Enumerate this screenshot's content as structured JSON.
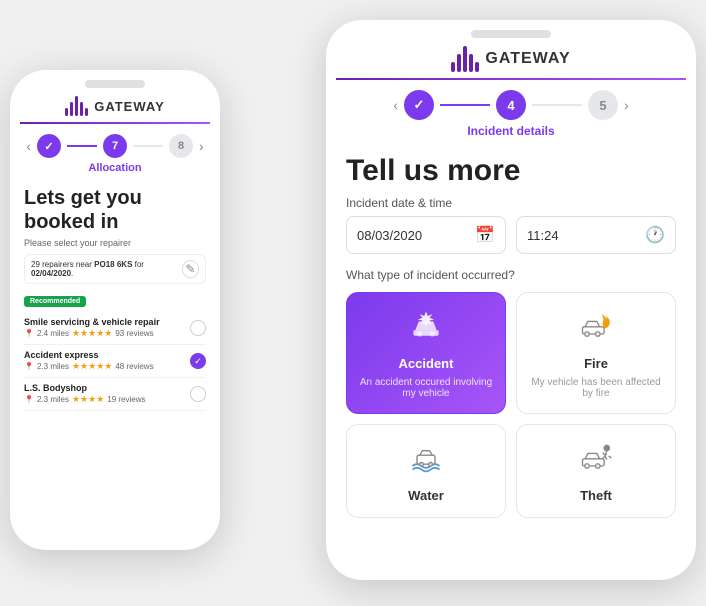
{
  "small_phone": {
    "logo_text": "GATEWAY",
    "steps": {
      "prev_arrow": "‹",
      "next_arrow": "›",
      "step_done_check": "✓",
      "step_active": "7",
      "step_inactive": "8",
      "label": "Allocation"
    },
    "headline": "Lets get you booked in",
    "subtext": "Please select your repairer",
    "repairers_row": {
      "text": "29 repairers near PO18 6KS for 02/04/2020.",
      "highlight_start": "PO18 6KS",
      "edit_icon": "✎"
    },
    "recommended_badge": "Recommended",
    "repairers": [
      {
        "name": "Smile servicing & vehicle repair",
        "distance": "2.4 miles",
        "stars": "★★★★★",
        "reviews": "93 reviews",
        "selected": false
      },
      {
        "name": "Accident express",
        "distance": "2.3 miles",
        "stars": "★★★★★",
        "reviews": "48 reviews",
        "selected": true
      },
      {
        "name": "L.S. Bodyshop",
        "distance": "2.3 miles",
        "stars": "★★★★",
        "reviews": "19 reviews",
        "selected": false
      }
    ]
  },
  "large_phone": {
    "logo_text": "GATEWAY",
    "steps": {
      "prev_arrow": "‹",
      "next_arrow": "›",
      "step_done_check": "✓",
      "step_active": "4",
      "step_inactive": "5",
      "label": "Incident details"
    },
    "page_title": "Tell us more",
    "date_label": "Incident date & time",
    "date_value": "08/03/2020",
    "time_value": "11:24",
    "calendar_icon": "📅",
    "clock_icon": "🕐",
    "incident_label": "What type of incident occurred?",
    "incident_types": [
      {
        "id": "accident",
        "title": "Accident",
        "desc": "An accident occured involving my vehicle",
        "selected": true
      },
      {
        "id": "fire",
        "title": "Fire",
        "desc": "My vehicle has been affected by fire",
        "selected": false
      },
      {
        "id": "water",
        "title": "Water",
        "desc": "",
        "selected": false
      },
      {
        "id": "theft",
        "title": "Theft",
        "desc": "",
        "selected": false
      }
    ]
  },
  "colors": {
    "purple": "#7c3aed",
    "green": "#16a34a",
    "red": "#e11d48",
    "star": "#f59e0b"
  }
}
